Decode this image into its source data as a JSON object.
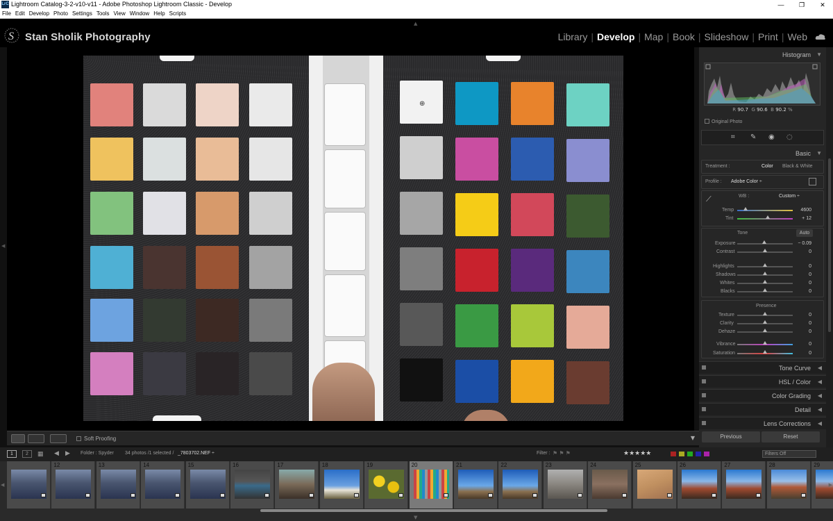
{
  "window": {
    "title": "Lightroom Catalog-3-2-v10-v11 - Adobe Photoshop Lightroom Classic - Develop",
    "app_badge": "LrC",
    "controls": [
      "—",
      "❐",
      "✕"
    ]
  },
  "menu": [
    "File",
    "Edit",
    "Develop",
    "Photo",
    "Settings",
    "Tools",
    "View",
    "Window",
    "Help",
    "Scripts"
  ],
  "identity_plate": "Stan Sholik Photography",
  "modules": [
    {
      "label": "Library",
      "active": false
    },
    {
      "label": "Develop",
      "active": true
    },
    {
      "label": "Map",
      "active": false
    },
    {
      "label": "Book",
      "active": false
    },
    {
      "label": "Slideshow",
      "active": false
    },
    {
      "label": "Print",
      "active": false
    },
    {
      "label": "Web",
      "active": false
    }
  ],
  "colors": {
    "accent": "#ffffff",
    "panel": "#262626",
    "background": "#000000"
  },
  "histogram": {
    "title": "Histogram",
    "readout": {
      "R_label": "R",
      "R": "90.7",
      "G_label": "G",
      "G": "90.6",
      "B_label": "B",
      "B": "90.2",
      "unit": "%"
    },
    "original_photo_label": "Original Photo"
  },
  "basic": {
    "title": "Basic",
    "treatment_label": "Treatment :",
    "treatment_color": "Color",
    "treatment_bw": "Black & White",
    "profile_label": "Profile :",
    "profile_value": "Adobe Color ÷",
    "wb_label": "WB :",
    "wb_value": "Custom ÷",
    "temp_label": "Temp",
    "temp_value": "4600",
    "temp_level": 0.15,
    "tint_label": "Tint",
    "tint_value": "+ 12",
    "tint_level": 0.55,
    "tone_label": "Tone",
    "auto_label": "Auto",
    "exposure_label": "Exposure",
    "exposure_value": "− 0.09",
    "contrast_label": "Contrast",
    "contrast_value": "0",
    "highlights_label": "Highlights",
    "highlights_value": "0",
    "shadows_label": "Shadows",
    "shadows_value": "0",
    "whites_label": "Whites",
    "whites_value": "0",
    "blacks_label": "Blacks",
    "blacks_value": "0",
    "presence_label": "Presence",
    "texture_label": "Texture",
    "texture_value": "0",
    "clarity_label": "Clarity",
    "clarity_value": "0",
    "dehaze_label": "Dehaze",
    "dehaze_value": "0",
    "vibrance_label": "Vibrance",
    "vibrance_value": "0",
    "saturation_label": "Saturation",
    "saturation_value": "0"
  },
  "collapsed_panels": [
    "Tone Curve",
    "HSL / Color",
    "Color Grading",
    "Detail",
    "Lens Corrections"
  ],
  "buttons": {
    "previous": "Previous",
    "reset": "Reset"
  },
  "toolbar": {
    "soft_proofing": "Soft Proofing"
  },
  "filmbar": {
    "pages": [
      "1",
      "2"
    ],
    "folder": "Folder : Spyder",
    "count": "34 photos /1 selected /",
    "filename": "_7803702.NEF ÷",
    "filter_label": "Filter :",
    "filters_off": "Filters Off"
  },
  "filmstrip": [
    {
      "num": "",
      "scene": "meeting",
      "selected": false
    },
    {
      "num": "12",
      "scene": "meeting",
      "selected": false
    },
    {
      "num": "13",
      "scene": "meeting",
      "selected": false
    },
    {
      "num": "14",
      "scene": "meeting",
      "selected": false
    },
    {
      "num": "15",
      "scene": "meeting",
      "selected": false
    },
    {
      "num": "16",
      "scene": "indoor",
      "selected": false
    },
    {
      "num": "17",
      "scene": "horse",
      "selected": false
    },
    {
      "num": "18",
      "scene": "tipi",
      "selected": false
    },
    {
      "num": "19",
      "scene": "flowers",
      "selected": false
    },
    {
      "num": "20",
      "scene": "colorchecker",
      "selected": true
    },
    {
      "num": "21",
      "scene": "sky",
      "selected": false
    },
    {
      "num": "22",
      "scene": "sky",
      "selected": false
    },
    {
      "num": "23",
      "scene": "rocks",
      "selected": false
    },
    {
      "num": "24",
      "scene": "rock",
      "selected": false
    },
    {
      "num": "25",
      "scene": "sandstone",
      "selected": false
    },
    {
      "num": "26",
      "scene": "scenic",
      "selected": false
    },
    {
      "num": "27",
      "scene": "scenic",
      "selected": false
    },
    {
      "num": "28",
      "scene": "mountain",
      "selected": false
    },
    {
      "num": "29",
      "scene": "scenic",
      "selected": false
    }
  ]
}
